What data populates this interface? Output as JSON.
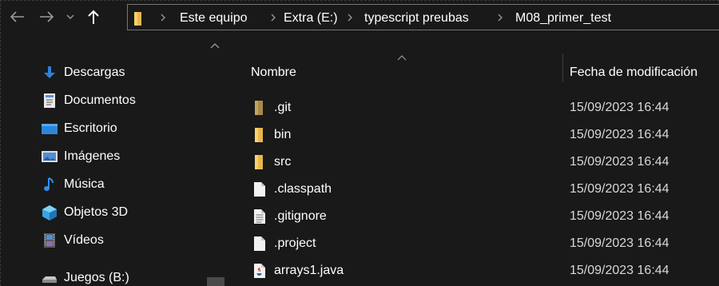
{
  "window": {
    "theme": "dark",
    "background": "#191919"
  },
  "address_bar": {
    "segments": [
      "Este equipo",
      "Extra (E:)",
      "typescript preubas",
      "M08_primer_test"
    ]
  },
  "nav_pane": {
    "items": [
      {
        "label": "Descargas",
        "icon": "download-arrow-icon"
      },
      {
        "label": "Documentos",
        "icon": "document-icon"
      },
      {
        "label": "Escritorio",
        "icon": "desktop-icon"
      },
      {
        "label": "Imágenes",
        "icon": "pictures-icon"
      },
      {
        "label": "Música",
        "icon": "music-note-icon"
      },
      {
        "label": "Objetos 3D",
        "icon": "3d-object-icon"
      },
      {
        "label": "Vídeos",
        "icon": "film-strip-icon"
      },
      {
        "label": "Juegos (B:)",
        "icon": "drive-icon"
      }
    ]
  },
  "file_list": {
    "columns": {
      "name": "Nombre",
      "modified": "Fecha de modificación"
    },
    "rows": [
      {
        "name": ".git",
        "modified": "15/09/2023 16:44",
        "icon": "folder-dim-icon"
      },
      {
        "name": "bin",
        "modified": "15/09/2023 16:44",
        "icon": "folder-icon"
      },
      {
        "name": "src",
        "modified": "15/09/2023 16:44",
        "icon": "folder-icon"
      },
      {
        "name": ".classpath",
        "modified": "15/09/2023 16:44",
        "icon": "blank-file-icon"
      },
      {
        "name": ".gitignore",
        "modified": "15/09/2023 16:44",
        "icon": "text-file-icon"
      },
      {
        "name": ".project",
        "modified": "15/09/2023 16:44",
        "icon": "blank-file-icon"
      },
      {
        "name": "arrays1.java",
        "modified": "15/09/2023 16:44",
        "icon": "java-file-icon"
      }
    ]
  },
  "colors": {
    "folder": "#e8b84a",
    "folder_dim": "#a8894a",
    "accent_blue": "#2f7fd8",
    "text": "#ffffff",
    "muted": "#9a9a9a"
  }
}
